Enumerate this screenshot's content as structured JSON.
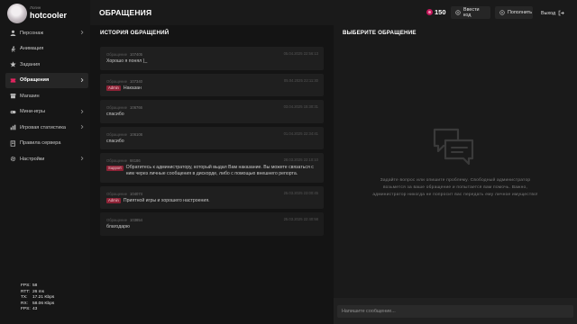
{
  "profile": {
    "login_caption": "Логин",
    "login_value": "hotcooler"
  },
  "sidebar": {
    "items": [
      {
        "label": "Персонаж",
        "icon": "user-icon"
      },
      {
        "label": "Анимация",
        "icon": "person-run-icon"
      },
      {
        "label": "Задания",
        "icon": "star-icon"
      },
      {
        "label": "Обращения",
        "icon": "ticket-icon",
        "active": true
      },
      {
        "label": "Магазин",
        "icon": "store-icon"
      },
      {
        "label": "Мини-игры",
        "icon": "gamepad-icon"
      },
      {
        "label": "Игровая статистика",
        "icon": "stats-icon"
      },
      {
        "label": "Правила сервера",
        "icon": "book-icon"
      },
      {
        "label": "Настройки",
        "icon": "gear-icon"
      }
    ]
  },
  "stats": [
    {
      "key": "FPS:",
      "value": "58"
    },
    {
      "key": "RTT:",
      "value": "26 ms"
    },
    {
      "key": "TX:",
      "value": "17.21 Kbps"
    },
    {
      "key": "RX:",
      "value": "58.06 Kbps"
    },
    {
      "key": "FPS:",
      "value": "43"
    }
  ],
  "header": {
    "title": "ОБРАЩЕНИЯ",
    "coins": "150",
    "enter_code": "Ввести код",
    "topup": "Пополнить",
    "logout": "Выход"
  },
  "history": {
    "title": "ИСТОРИЯ ОБРАЩЕНИЙ",
    "tickets": [
      {
        "label": "Обращение",
        "number": "107405",
        "date": "05.04.2025 22:56:13",
        "tag": "",
        "text": "Хорошо я понял )_"
      },
      {
        "label": "Обращение",
        "number": "107340",
        "date": "05.04.2025 22:11:30",
        "tag": "Admin",
        "text": "Наказан"
      },
      {
        "label": "Обращение",
        "number": "106766",
        "date": "03.04.2025 15:30:31",
        "tag": "",
        "text": "спасибо"
      },
      {
        "label": "Обращение",
        "number": "106108",
        "date": "01.04.2025 22:34:41",
        "tag": "",
        "text": "спасибо"
      },
      {
        "label": "Обращение",
        "number": "66186",
        "date": "28.03.2025 22:10:10",
        "tag": "Support",
        "text": "Обратитесь к администратору, который выдал Вам наказание. Вы можете связаться с ним через личные сообщения в дискорде, либо с помощью внешнего репорта."
      },
      {
        "label": "Обращение",
        "number": "104074",
        "date": "25.03.2025 23:00:45",
        "tag": "Admin",
        "text": "Приятной игры и хорошего настроения."
      },
      {
        "label": "Обращение",
        "number": "103854",
        "date": "25.03.2025 22:40:58",
        "tag": "",
        "text": "благодарю"
      }
    ]
  },
  "select": {
    "title": "ВЫБЕРИТЕ ОБРАЩЕНИЕ",
    "hint": "Задайте вопрос или опишите проблему. Свободный администратор возьмется за ваше обращение и попытается вам помочь. Важно, администратор никогда не попросит вас передать ему личное имущество!",
    "input_placeholder": "Напишите сообщение..."
  },
  "colors": {
    "accent": "#c2185b",
    "tag_bg": "#8b2235",
    "background": "#1a1a1a"
  }
}
